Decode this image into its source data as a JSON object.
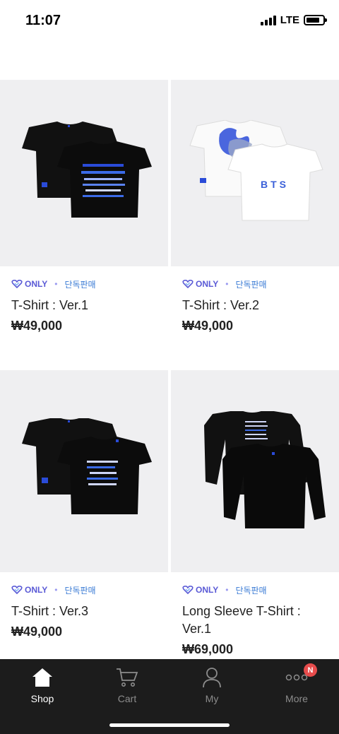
{
  "status_bar": {
    "time": "11:07",
    "network": "LTE"
  },
  "products": [
    {
      "only_label": "ONLY",
      "exclusive_label": "단독판매",
      "name": "T-Shirt : Ver.1",
      "price": "₩49,000",
      "image_icon": "black-tshirt-pair-image"
    },
    {
      "only_label": "ONLY",
      "exclusive_label": "단독판매",
      "name": "T-Shirt : Ver.2",
      "price": "₩49,000",
      "image_icon": "white-tshirt-pair-image",
      "back_print": "BTS"
    },
    {
      "only_label": "ONLY",
      "exclusive_label": "단독판매",
      "name": "T-Shirt : Ver.3",
      "price": "₩49,000",
      "image_icon": "black-tshirt-pair-image"
    },
    {
      "only_label": "ONLY",
      "exclusive_label": "단독판매",
      "name": "Long Sleeve T-Shirt : Ver.1",
      "price": "₩69,000",
      "image_icon": "black-longsleeve-pair-image"
    }
  ],
  "tabbar": {
    "tabs": [
      {
        "label": "Shop",
        "icon": "home-icon",
        "active": true
      },
      {
        "label": "Cart",
        "icon": "cart-icon",
        "active": false
      },
      {
        "label": "My",
        "icon": "person-icon",
        "active": false
      },
      {
        "label": "More",
        "icon": "more-icon",
        "active": false,
        "badge": "N"
      }
    ]
  },
  "colors": {
    "only_purple": "#5a5ad6",
    "exclusive_blue": "#3a7bd5",
    "tabbar_bg": "#1c1c1c",
    "badge_red": "#e74c4c",
    "thumb_bg": "#efeff1"
  }
}
